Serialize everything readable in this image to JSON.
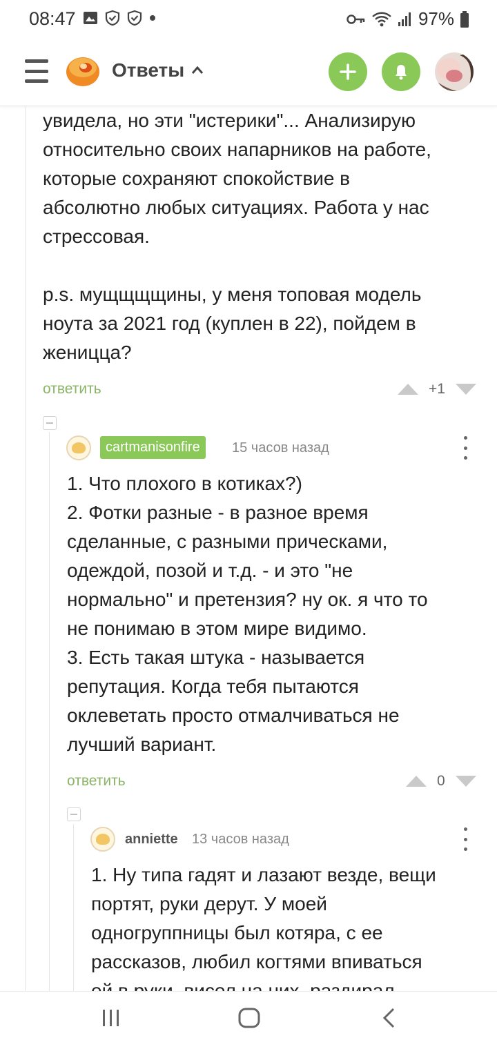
{
  "status_bar": {
    "time": "08:47",
    "battery": "97%"
  },
  "header": {
    "title": "Ответы",
    "accent_color": "#8ac858"
  },
  "comments": [
    {
      "text": "увидела, но эти \"истерики\"... Анализирую\nотносительно своих напарников на работе,\nкоторые сохраняют спокойствие в\nабсолютно любых ситуациях. Работа у нас\nстрессовая.\n\np.s. мущщщщины, у меня топовая модель\nноута за 2021 год (куплен в 22), пойдем в\nженицца?",
      "reply_label": "ответить",
      "score": "+1"
    },
    {
      "username": "cartmanisonfire",
      "time": "15 часов назад",
      "text": "1. Что плохого в котиках?)\n2. Фотки разные - в разное время\nсделанные, с разными прическами,\nодеждой, позой и т.д. - и это \"не\nнормально\" и претензия? ну ок. я что то\nне понимаю в этом мире видимо.\n3. Есть такая штука - называется\nрепутация. Когда тебя пытаются\nоклеветать просто отмалчиваться не\nлучший вариант.",
      "reply_label": "ответить",
      "score": "0"
    },
    {
      "username": "anniette",
      "time": "13 часов назад",
      "text": "1. Ну типа гадят и лазают везде, вещи\nпортят, руки дерут. У моей\nодногруппницы был котяра, с ее\nрассказов, любил когтями впиваться\nей в руки, висел на них, раздирал"
    }
  ]
}
